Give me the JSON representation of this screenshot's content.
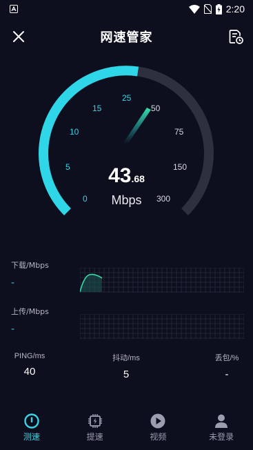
{
  "status_bar": {
    "time": "2:20",
    "notif_icon": "app-notification-icon"
  },
  "header": {
    "title": "网速管家",
    "close_icon": "close-icon",
    "history_icon": "history-icon"
  },
  "gauge": {
    "ticks": [
      "0",
      "5",
      "10",
      "15",
      "25",
      "50",
      "75",
      "150",
      "300"
    ],
    "progress": 0.53,
    "speed_int": "43",
    "speed_dec": ".68",
    "unit": "Mbps",
    "accent": "#2ed6e8"
  },
  "download": {
    "label": "下载/Mbps",
    "value": "-"
  },
  "upload": {
    "label": "上传/Mbps",
    "value": "-"
  },
  "stats": {
    "ping": {
      "label": "PING/ms",
      "value": "40"
    },
    "jitter": {
      "label": "抖动/ms",
      "value": "5"
    },
    "loss": {
      "label": "丢包/%",
      "value": "-"
    }
  },
  "nav": [
    {
      "label": "测速",
      "icon": "speedometer-icon",
      "active": true
    },
    {
      "label": "提速",
      "icon": "chip-icon",
      "active": false
    },
    {
      "label": "视频",
      "icon": "play-icon",
      "active": false
    },
    {
      "label": "未登录",
      "icon": "user-icon",
      "active": false
    }
  ]
}
